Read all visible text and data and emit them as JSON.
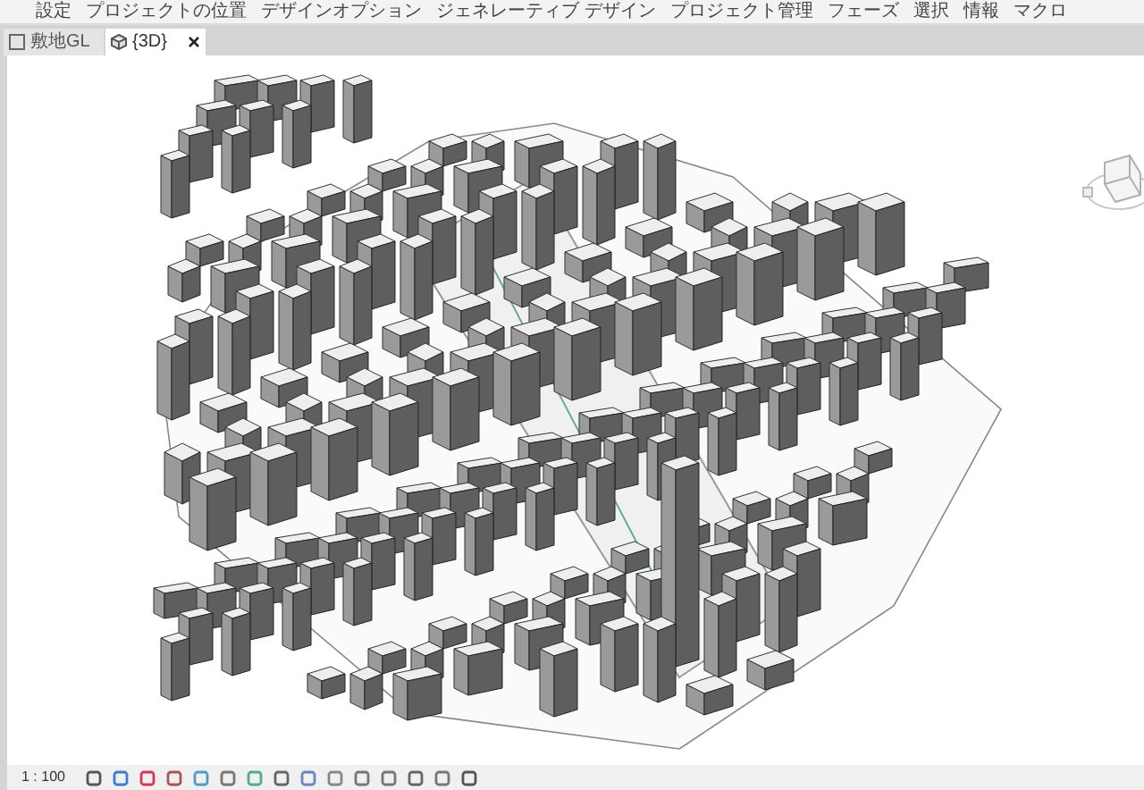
{
  "ribbon": {
    "labels": [
      "設定",
      "プロジェクトの位置",
      "デザインオプション",
      "ジェネレーティブ デザイン",
      "プロジェクト管理",
      "フェーズ",
      "選択",
      "情報",
      "マクロ"
    ]
  },
  "tabs": [
    {
      "label": "敷地GL",
      "kind": "plan",
      "selected": false,
      "closable": false
    },
    {
      "label": "{3D}",
      "kind": "model",
      "selected": true,
      "closable": true
    }
  ],
  "view_control_bar": {
    "scale": "1 : 100"
  }
}
